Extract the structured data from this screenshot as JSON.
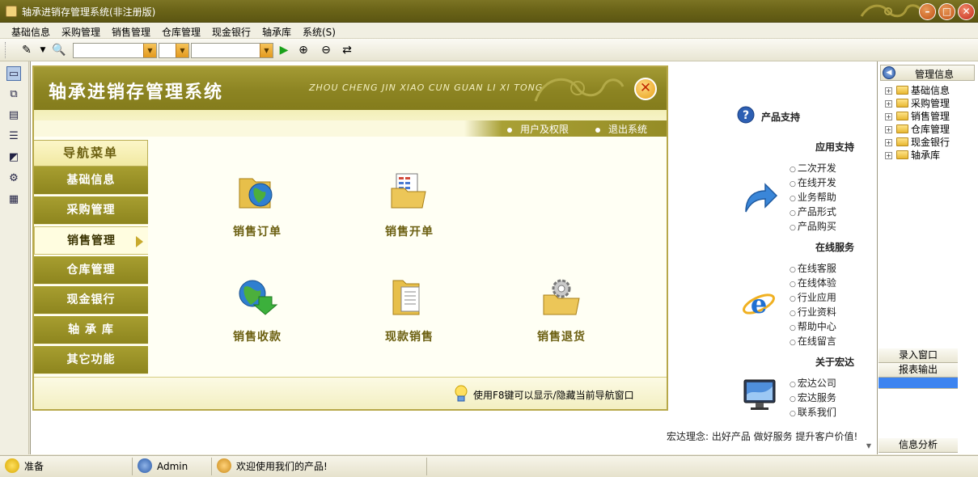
{
  "window": {
    "title": "轴承进销存管理系统(非注册版)"
  },
  "menu": [
    "基础信息",
    "采购管理",
    "销售管理",
    "仓库管理",
    "现金银行",
    "轴承库",
    "系统(S)"
  ],
  "nav_window": {
    "title": "轴承进销存管理系统",
    "pinyin": "ZHOU CHENG JIN XIAO CUN GUAN LI XI TONG",
    "links": [
      "用户及权限",
      "退出系统"
    ],
    "menu_head": "导航菜单",
    "menu_items": [
      "基础信息",
      "采购管理",
      "销售管理",
      "仓库管理",
      "现金银行",
      "轴 承 库",
      "其它功能"
    ],
    "active_item": "销售管理",
    "functions": [
      "销售订单",
      "销售开单",
      "销售收款",
      "现款销售",
      "销售退货"
    ],
    "footer_tip": "使用F8键可以显示/隐藏当前导航窗口"
  },
  "info_panel": {
    "product_support": "产品支持",
    "sections": [
      {
        "title": "应用支持",
        "links": [
          "二次开发",
          "在线开发",
          "业务帮助",
          "产品形式",
          "产品购买"
        ]
      },
      {
        "title": "在线服务",
        "links": [
          "在线客服",
          "在线体验",
          "行业应用",
          "行业资料",
          "帮助中心",
          "在线留言"
        ]
      },
      {
        "title": "关于宏达",
        "links": [
          "宏达公司",
          "宏达服务",
          "联系我们"
        ]
      }
    ],
    "motto": "宏达理念: 出好产品  做好服务  提升客户价值!"
  },
  "right_panel": {
    "title": "管理信息",
    "tree": [
      "基础信息",
      "采购管理",
      "销售管理",
      "仓库管理",
      "现金银行",
      "轴承库"
    ],
    "tabs": [
      "录入窗口",
      "报表输出",
      "",
      "信息分析"
    ]
  },
  "status_bar": {
    "status": "准备",
    "user": "Admin",
    "welcome": "欢迎使用我们的产品!"
  },
  "colors": {
    "olive": "#8d851e",
    "title_bar": "#6b6418",
    "nav_text": "#6b5f10",
    "selected_tab": "#3d84f0"
  }
}
